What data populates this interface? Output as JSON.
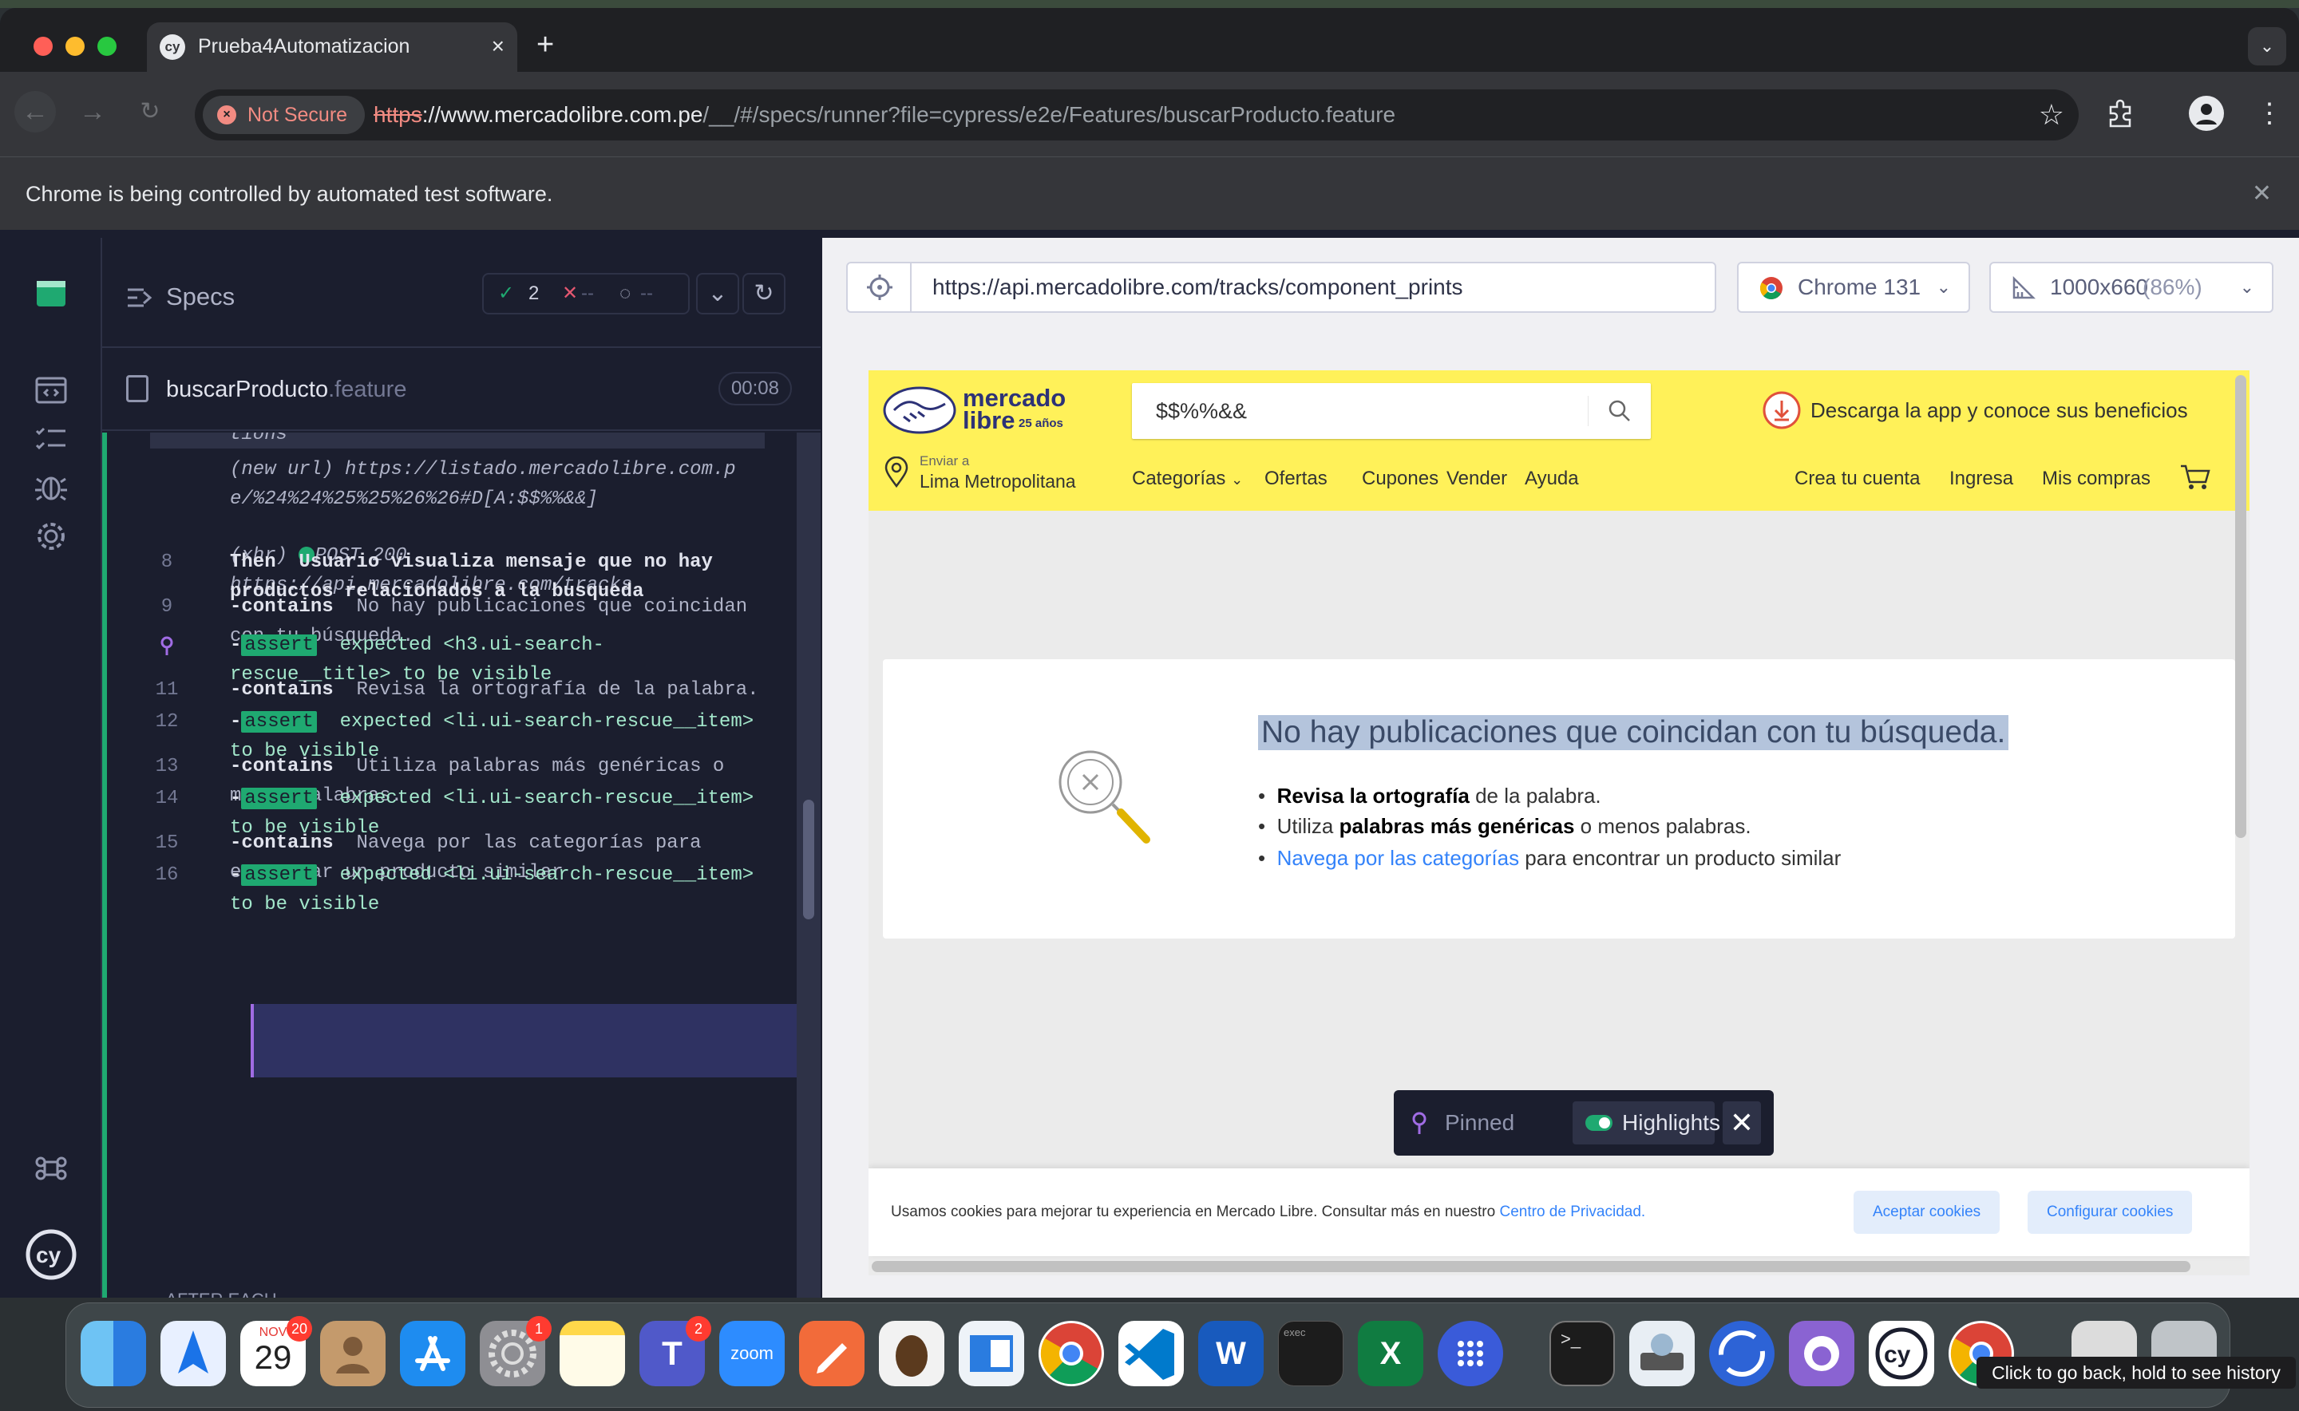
{
  "browser": {
    "tab_title": "Prueba4Automatizacion",
    "tab_favicon": "cy",
    "security_label": "Not Secure",
    "url_scheme": "https",
    "url_host": "://www.mercadolibre.com.pe",
    "url_path": "/__/#/specs/runner?file=cypress/e2e/Features/buscarProducto.feature",
    "infobar_text": "Chrome is being controlled by automated test software."
  },
  "reporter": {
    "specs_label": "Specs",
    "passed": "2",
    "failed": "--",
    "pending": "--",
    "file_name": "buscarProducto",
    "file_ext": ".feature",
    "duration": "00:08",
    "partial_text": "tions",
    "url_cmd_name": "(new url)",
    "url_cmd_value": "https://listado.mercadolibre.com.pe/%24%24%25%25%26%26#D[A:$$%%&&]",
    "xhr_name": "(xhr)",
    "xhr_method": "POST 200",
    "xhr_url": "https://api.mercadolibre.com/tracks",
    "commands": [
      {
        "num": "8",
        "name": "Then",
        "msg": "Usuario visualiza mensaje que no hay productos relacionados a la busqueda"
      },
      {
        "num": "9",
        "name": "-contains",
        "msg": "No hay publicaciones que coincidan con tu búsqueda."
      },
      {
        "num": "",
        "name": "-",
        "tag": "assert",
        "msg": "expected <h3.ui-search-rescue__title> to be visible"
      },
      {
        "num": "11",
        "name": "-contains",
        "msg": "Revisa la ortografía de la palabra."
      },
      {
        "num": "12",
        "name": "-",
        "tag": "assert",
        "msg": "expected <li.ui-search-rescue__item> to be visible"
      },
      {
        "num": "13",
        "name": "-contains",
        "msg": "Utiliza palabras más genéricas o menos palabras."
      },
      {
        "num": "14",
        "name": "-",
        "tag": "assert",
        "msg": "expected <li.ui-search-rescue__item> to be visible"
      },
      {
        "num": "15",
        "name": "-contains",
        "msg": "Navega por las categorías para encontrar un producto similar"
      },
      {
        "num": "16",
        "name": "-",
        "tag": "assert",
        "msg": "expected <li.ui-search-rescue__item> to be visible"
      }
    ],
    "after_each": "AFTER EACH"
  },
  "aut": {
    "url": "https://api.mercadolibre.com/tracks/component_prints",
    "browser_label": "Chrome 131",
    "viewport": "1000x660",
    "zoom": "(86%)"
  },
  "site": {
    "logo_line1": "mercado",
    "logo_line2": "libre",
    "logo_years": "25 años",
    "search_query": "$$%%&&",
    "promo": "Descarga la app y conoce sus beneficios",
    "loc_label": "Enviar a",
    "loc_value": "Lima Metropolitana",
    "nav": [
      "Categorías",
      "Ofertas",
      "Cupones",
      "Vender",
      "Ayuda"
    ],
    "user_nav": [
      "Crea tu cuenta",
      "Ingresa",
      "Mis compras"
    ],
    "no_results_title": "No hay publicaciones que coincidan con tu búsqueda.",
    "tip1_bold": "Revisa la ortografía",
    "tip1_rest": " de la palabra.",
    "tip2_pre": "Utiliza ",
    "tip2_bold": "palabras más genéricas",
    "tip2_rest": " o menos palabras.",
    "tip3_link": "Navega por las categorías",
    "tip3_rest": " para encontrar un producto similar",
    "cookie_text": "Usamos cookies para mejorar tu experiencia en Mercado Libre. Consultar más en nuestro ",
    "cookie_link": "Centro de Privacidad.",
    "accept_cookies": "Aceptar cookies",
    "config_cookies": "Configurar cookies"
  },
  "pin_panel": {
    "pinned": "Pinned",
    "highlights": "Highlights"
  },
  "dock": {
    "calendar_month": "NOV",
    "calendar_day": "29",
    "calendar_badge": "20",
    "settings_badge": "1",
    "teams_badge": "2",
    "zoom_label": "zoom",
    "exec_label": "exec",
    "tooltip": "Click to go back, hold to see history"
  },
  "colors": {
    "cypress_green": "#1fa971",
    "ml_yellow": "#fff159",
    "ml_blue": "#3483fa",
    "assert_purple": "#a06ce4"
  }
}
